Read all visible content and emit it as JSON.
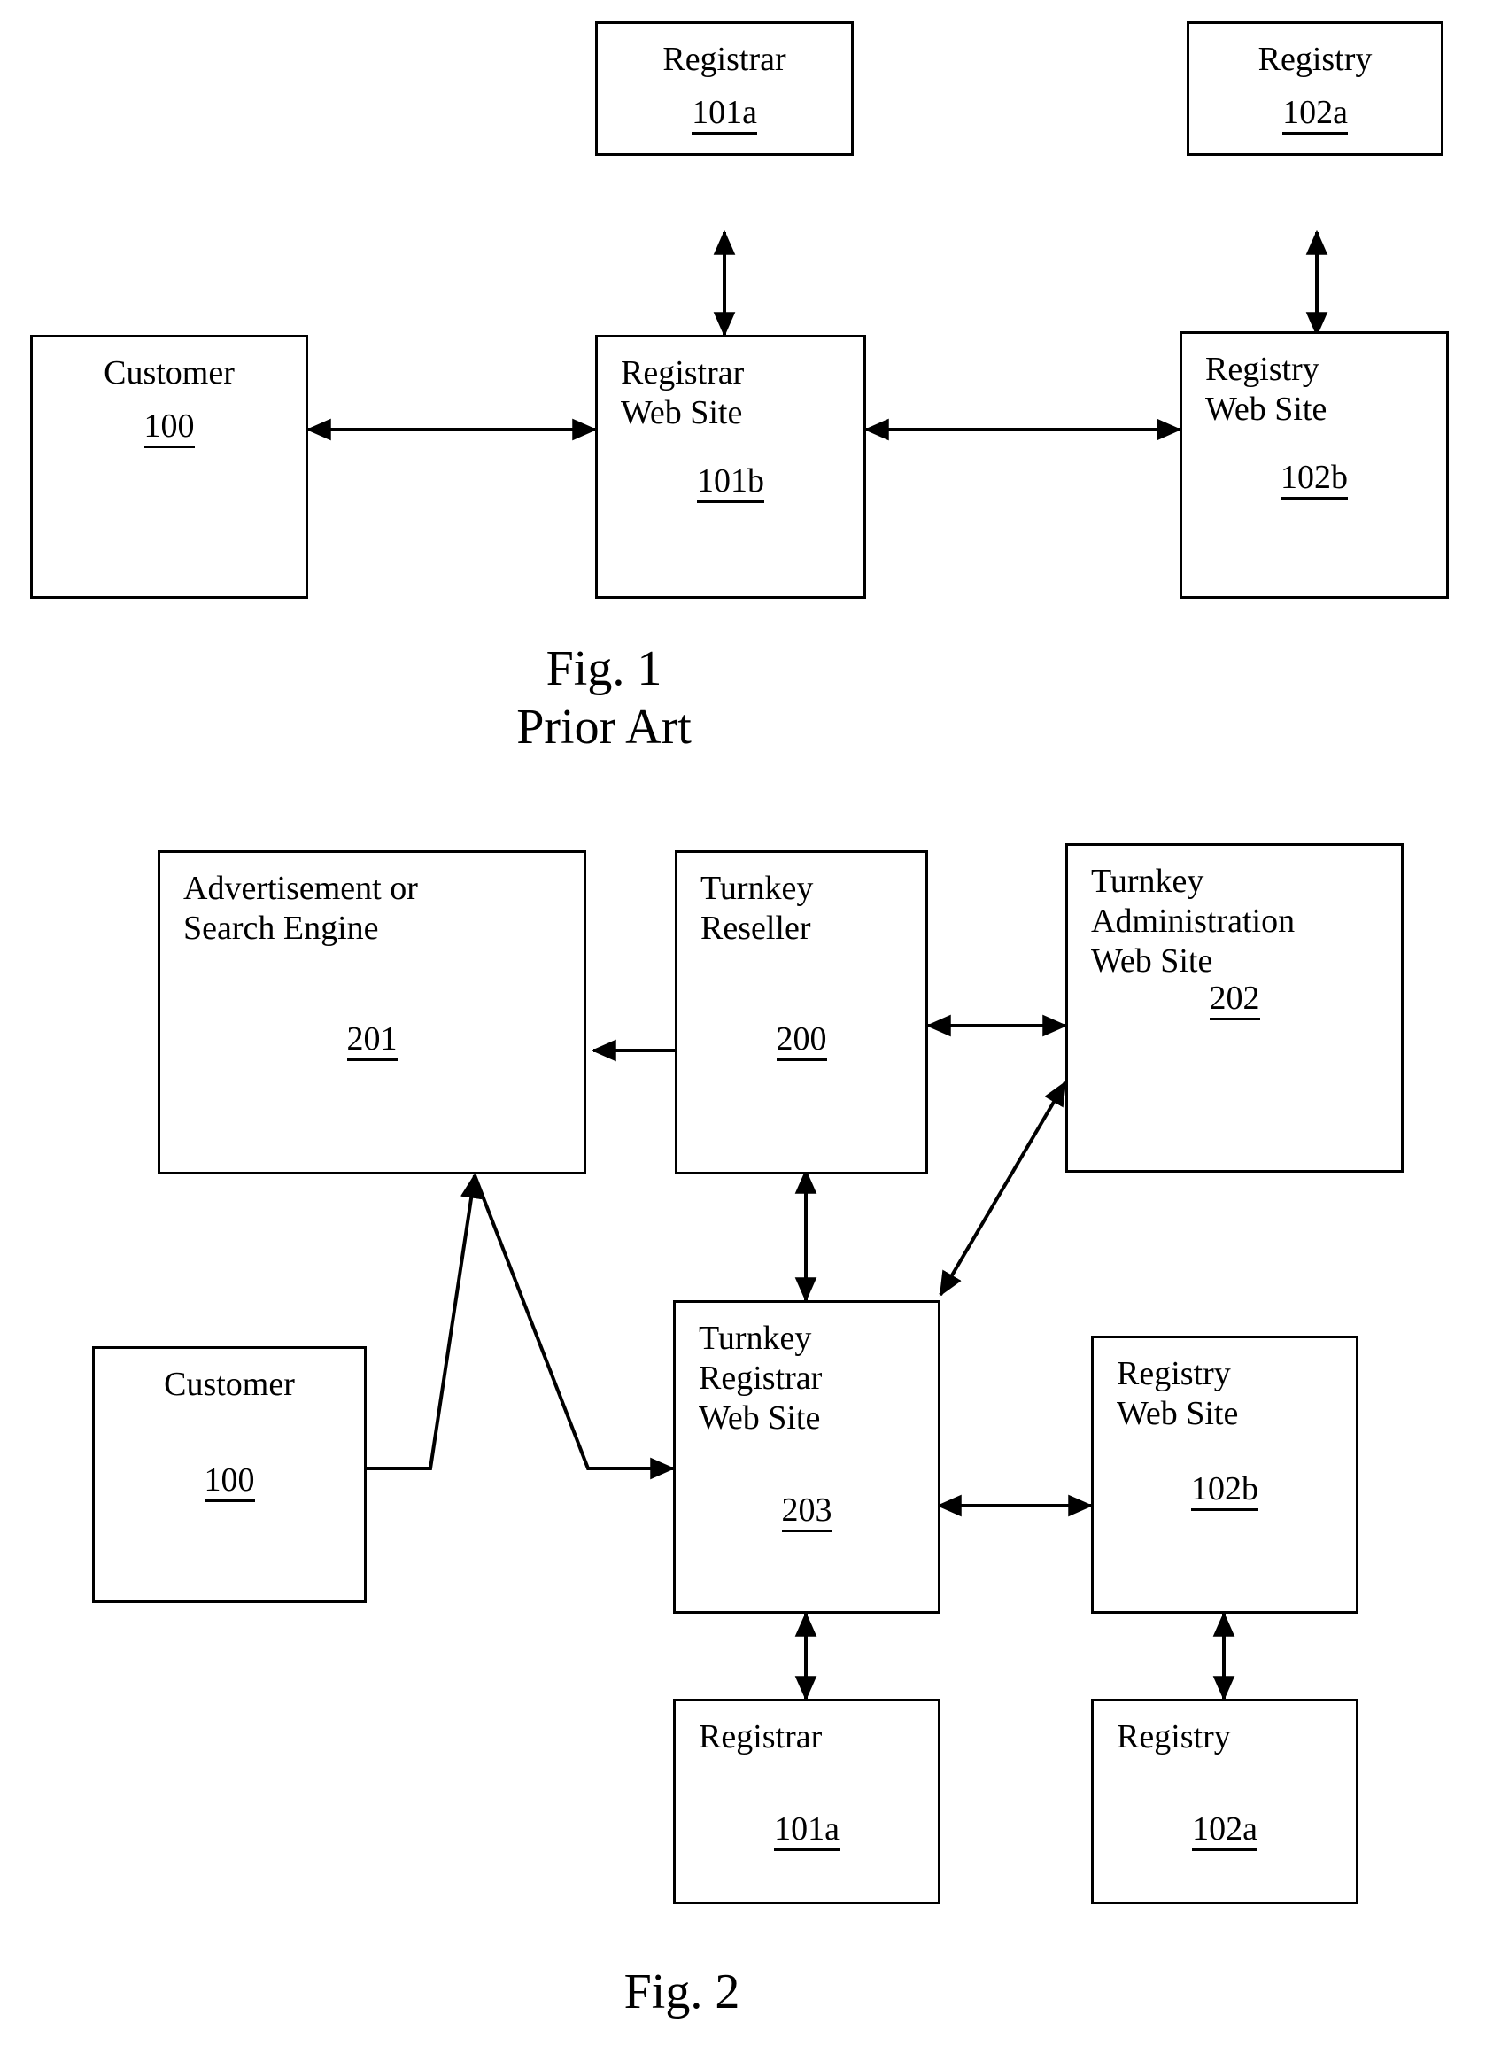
{
  "document": {
    "kind": "patent-figure-sheet",
    "figures": [
      "Fig. 1",
      "Fig. 2"
    ]
  },
  "colors": {
    "ink": "#000000",
    "paper": "#ffffff"
  },
  "fig1": {
    "caption": "Fig. 1\nPrior Art",
    "nodes": {
      "registrar_101a": {
        "title": "Registrar",
        "ref": "101a"
      },
      "registry_102a": {
        "title": "Registry",
        "ref": "102a"
      },
      "customer_100": {
        "title": "Customer",
        "ref": "100"
      },
      "registrar_web_101b": {
        "title": "Registrar\nWeb Site",
        "ref": "101b"
      },
      "registry_web_102b": {
        "title": "Registry\nWeb Site",
        "ref": "102b"
      }
    },
    "edges": [
      {
        "from": "registrar_web_101b",
        "to": "registrar_101a",
        "style": "double-arrow-vertical"
      },
      {
        "from": "registry_web_102b",
        "to": "registry_102a",
        "style": "double-arrow-vertical"
      },
      {
        "from": "customer_100",
        "to": "registrar_web_101b",
        "style": "double-arrow-horizontal"
      },
      {
        "from": "registrar_web_101b",
        "to": "registry_web_102b",
        "style": "double-arrow-horizontal"
      }
    ]
  },
  "fig2": {
    "caption": "Fig. 2",
    "nodes": {
      "advertisement_201": {
        "title": "Advertisement or\nSearch Engine",
        "ref": "201"
      },
      "turnkey_reseller_200": {
        "title": "Turnkey\nReseller",
        "ref": "200"
      },
      "turnkey_admin_202": {
        "title": "Turnkey\nAdministration\nWeb Site",
        "ref": "202"
      },
      "customer_100": {
        "title": "Customer",
        "ref": "100"
      },
      "turnkey_registrar_web_203": {
        "title": "Turnkey\nRegistrar\nWeb Site",
        "ref": "203"
      },
      "registry_web_102b": {
        "title": "Registry\nWeb Site",
        "ref": "102b"
      },
      "registrar_101a": {
        "title": "Registrar",
        "ref": "101a"
      },
      "registry_102a": {
        "title": "Registry",
        "ref": "102a"
      }
    },
    "edges": [
      {
        "from": "turnkey_reseller_200",
        "to": "advertisement_201",
        "style": "single-arrow-left"
      },
      {
        "from": "turnkey_reseller_200",
        "to": "turnkey_admin_202",
        "style": "double-arrow-horizontal"
      },
      {
        "from": "turnkey_reseller_200",
        "to": "turnkey_registrar_web_203",
        "style": "double-arrow-vertical"
      },
      {
        "from": "turnkey_registrar_web_203",
        "to": "turnkey_admin_202",
        "style": "double-arrow-diagonal"
      },
      {
        "from": "customer_100",
        "to": "advertisement_201",
        "style": "elbow-arrow-up"
      },
      {
        "from": "customer_100",
        "to": "turnkey_registrar_web_203",
        "style": "elbow-arrow-right"
      },
      {
        "from": "turnkey_registrar_web_203",
        "to": "registry_web_102b",
        "style": "double-arrow-horizontal"
      },
      {
        "from": "turnkey_registrar_web_203",
        "to": "registrar_101a",
        "style": "double-arrow-vertical"
      },
      {
        "from": "registry_web_102b",
        "to": "registry_102a",
        "style": "double-arrow-vertical"
      }
    ]
  }
}
